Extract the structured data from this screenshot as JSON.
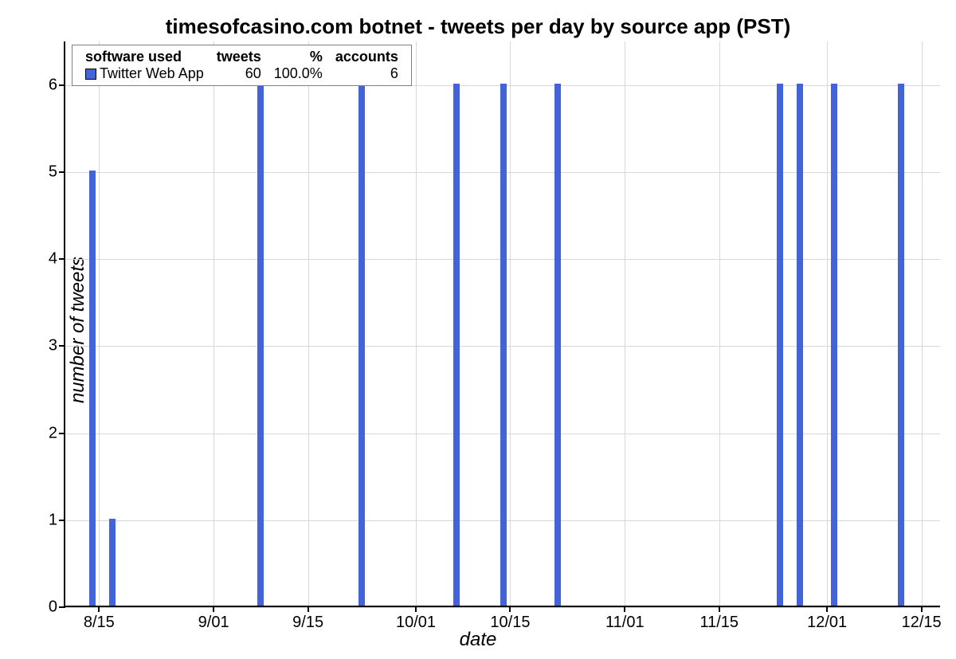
{
  "chart_data": {
    "type": "bar",
    "title": "timesofcasino.com botnet - tweets per day by source app (PST)",
    "xlabel": "date",
    "ylabel": "number of tweets",
    "ylim": [
      0,
      6.5
    ],
    "yticks": [
      0,
      1,
      2,
      3,
      4,
      5,
      6
    ],
    "xticks": [
      "8/15",
      "9/01",
      "9/15",
      "10/01",
      "10/15",
      "11/01",
      "11/15",
      "12/01",
      "12/15"
    ],
    "series": [
      {
        "name": "Twitter Web App",
        "data": [
          {
            "x": "8/14",
            "y": 5
          },
          {
            "x": "8/17",
            "y": 1
          },
          {
            "x": "9/08",
            "y": 6
          },
          {
            "x": "9/23",
            "y": 6
          },
          {
            "x": "10/07",
            "y": 6
          },
          {
            "x": "10/14",
            "y": 6
          },
          {
            "x": "10/22",
            "y": 6
          },
          {
            "x": "11/24",
            "y": 6
          },
          {
            "x": "11/27",
            "y": 6
          },
          {
            "x": "12/02",
            "y": 6
          },
          {
            "x": "12/12",
            "y": 6
          }
        ]
      }
    ],
    "legend": {
      "columns": [
        "software used",
        "tweets",
        "%",
        "accounts"
      ],
      "rows": [
        {
          "swatch": "#4363d8",
          "software": "Twitter Web App",
          "tweets": "60",
          "pct": "100.0%",
          "accounts": "6"
        }
      ]
    },
    "color": "#4363d8"
  }
}
